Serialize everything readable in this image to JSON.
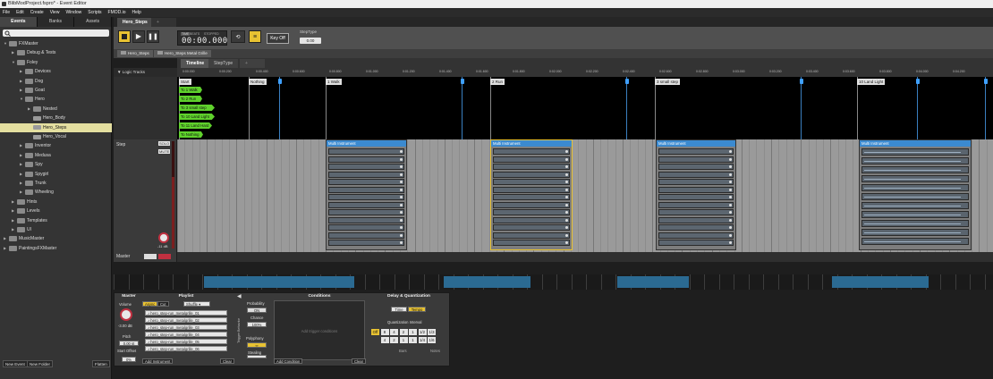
{
  "window": {
    "title": "BlibModProject.fspro* - Event Editor"
  },
  "menu": [
    "File",
    "Edit",
    "Create",
    "View",
    "Window",
    "Scripts",
    "FMOD.io",
    "Help"
  ],
  "browser": {
    "tabs": [
      "Events",
      "Banks",
      "Assets"
    ],
    "tree": [
      {
        "label": "FXMaster",
        "depth": 0,
        "open": true
      },
      {
        "label": "Debug & Tests",
        "depth": 1
      },
      {
        "label": "Foley",
        "depth": 1,
        "open": true
      },
      {
        "label": "Devices",
        "depth": 2
      },
      {
        "label": "Dog",
        "depth": 2
      },
      {
        "label": "Goat",
        "depth": 2
      },
      {
        "label": "Hero",
        "depth": 2,
        "open": true
      },
      {
        "label": "Nested",
        "depth": 3
      },
      {
        "label": "Hero_Body",
        "depth": 3,
        "event": true
      },
      {
        "label": "Hero_Steps",
        "depth": 3,
        "event": true,
        "selected": true
      },
      {
        "label": "Hero_Vocal",
        "depth": 3,
        "event": true
      },
      {
        "label": "Inventor",
        "depth": 2
      },
      {
        "label": "Medusa",
        "depth": 2
      },
      {
        "label": "Spy",
        "depth": 2
      },
      {
        "label": "Spygirl",
        "depth": 2
      },
      {
        "label": "Trunk",
        "depth": 2
      },
      {
        "label": "Wheeling",
        "depth": 2
      },
      {
        "label": "Hints",
        "depth": 1
      },
      {
        "label": "Levels",
        "depth": 1
      },
      {
        "label": "Templates",
        "depth": 1
      },
      {
        "label": "UI",
        "depth": 1
      },
      {
        "label": "MusicMaster",
        "depth": 0
      },
      {
        "label": "PaintingsFXMaster",
        "depth": 0
      }
    ],
    "buttons": {
      "new_event": "New Event",
      "new_folder": "New Folder",
      "flatten": "Flatten"
    }
  },
  "editor": {
    "tab": "Hero_Steps",
    "transport": {
      "time": "00:00.000",
      "mode_time": "TIME",
      "mode_beats": "BEATS",
      "status": "STOPPED",
      "key_off": "Key Off",
      "param_label": "StepType",
      "param_value": "0.00"
    },
    "breadcrumbs": [
      "Hero_Steps",
      "Hero_Steps Metal Grille"
    ],
    "subtabs": [
      "Timeline",
      "StepType"
    ],
    "logic_label": "Logic Tracks",
    "ruler": [
      "0:00.000",
      "0:00.200",
      "0:00.400",
      "0:00.600",
      "0:00.800",
      "0:01.000",
      "0:01.200",
      "0:01.400",
      "0:01.600",
      "0:01.800",
      "0:02.000",
      "0:02.200",
      "0:02.400",
      "0:02.600",
      "0:02.800",
      "0:03.000",
      "0:03.200",
      "0:03.400",
      "0:03.600",
      "0:03.800",
      "0:04.000",
      "0:04.200"
    ],
    "markers": [
      "Start",
      "Nothing",
      "1 Walk",
      "2 Run",
      "3 small step",
      "10 Land Light"
    ],
    "green_labels": [
      "To 1 Walk",
      "To 2 Run",
      "To 3 small step",
      "To 10 Land Light",
      "To 11 Land Hard",
      "To Nothing"
    ],
    "track": {
      "name": "Step",
      "solo": "SOLO",
      "mute": "MUTE",
      "volume": "-11 dB"
    },
    "instrument_label": "Multi Instrument",
    "master_label": "Master"
  },
  "deck": {
    "master": {
      "title": "Master",
      "volume_label": "Volume",
      "volume_value": "-3.00 dB",
      "pitch_label": "Pitch",
      "pitch_value": "0.00 st",
      "start_offset_label": "Start Offset",
      "start_offset_value": "0%"
    },
    "playlist": {
      "title": "Playlist",
      "async": "Async",
      "cut": "Cut",
      "shuffle": "Shuffle",
      "items": [
        "hero_step-run_metalgrille_01",
        "hero_step-run_metalgrille_02",
        "hero_step-run_metalgrille_03",
        "hero_step-run_metalgrille_04",
        "hero_step-run_metalgrille_05",
        "hero_step-run_metalgrille_06"
      ],
      "add_instrument": "Add Instrument",
      "clear": "Clear"
    },
    "trigger": {
      "side_label": "Trigger Behavior",
      "probability": "Probability",
      "probability_value": "ON",
      "chance": "Chance",
      "chance_value": "100%",
      "polyphony": "Polyphony",
      "polyphony_value": "∞",
      "stealing": "Stealing"
    },
    "conditions": {
      "title": "Conditions",
      "placeholder": "Add trigger conditions",
      "add": "Add Condition",
      "clear": "Clear"
    },
    "delay": {
      "title": "Delay & Quantization",
      "time": "Time",
      "tempo": "Tempo",
      "interval_label": "Quantization Interval",
      "bars_row1": [
        "Off",
        "8",
        "4",
        "2",
        "1",
        "1/2",
        "1/3"
      ],
      "bars_row2": [
        "4",
        "2",
        "1",
        "1",
        "1/4",
        "1/6"
      ],
      "bars_label": "Bars",
      "notes_label": "Notes"
    }
  }
}
